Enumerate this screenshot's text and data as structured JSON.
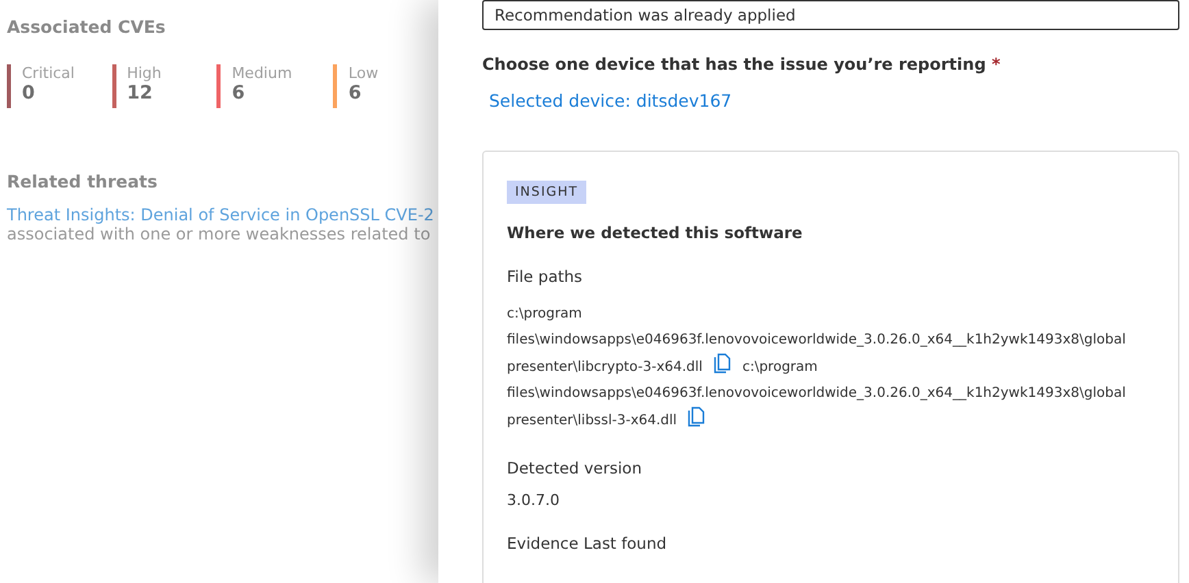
{
  "cves": {
    "title": "Associated CVEs",
    "items": [
      {
        "label": "Critical",
        "count": "0",
        "color": "#a05a5e"
      },
      {
        "label": "High",
        "count": "12",
        "color": "#c4625f"
      },
      {
        "label": "Medium",
        "count": "6",
        "color": "#ef6466"
      },
      {
        "label": "Low",
        "count": "6",
        "color": "#fba35e"
      }
    ]
  },
  "related_threats": {
    "title": "Related threats",
    "link": "Threat Insights: Denial of Service in OpenSSL CVE-2",
    "description": "associated with one or more weaknesses related to"
  },
  "panel": {
    "dropdown_value": "Recommendation was already applied",
    "device_label": "Choose one device that has the issue you’re reporting",
    "required_mark": "*",
    "selected_device": "Selected device: ditsdev167",
    "insight": {
      "badge": "INSIGHT",
      "heading": "Where we detected this software",
      "file_paths_label": "File paths",
      "file_paths": [
        {
          "lines": [
            "c:\\program",
            "files\\windowsapps\\e046963f.lenovovoiceworldwide_3.0.26.0_x64__k1h2ywk1493x8\\global",
            "presenter\\libcrypto-3-x64.dll"
          ]
        },
        {
          "lines": [
            "c:\\program",
            "files\\windowsapps\\e046963f.lenovovoiceworldwide_3.0.26.0_x64__k1h2ywk1493x8\\global",
            "presenter\\libssl-3-x64.dll"
          ]
        }
      ],
      "version_label": "Detected version",
      "version": "3.0.7.0",
      "evidence_label": "Evidence Last found"
    }
  }
}
